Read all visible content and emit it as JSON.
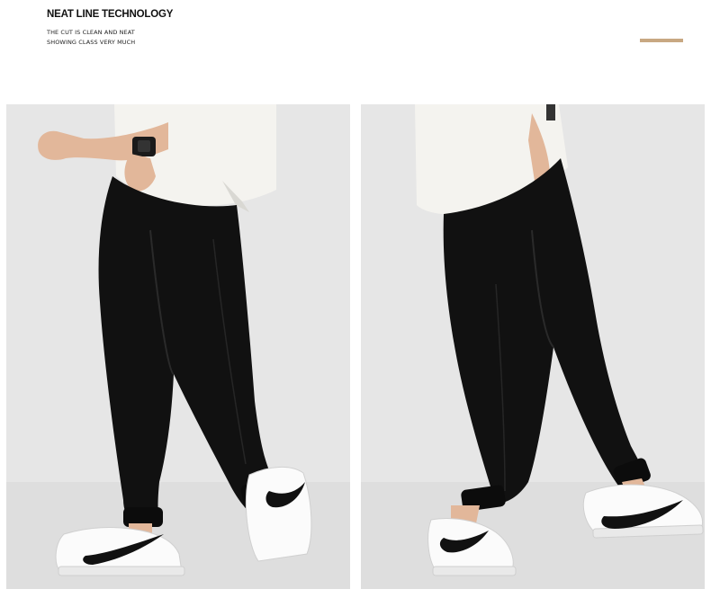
{
  "header": {
    "title": "NEAT LINE TECHNOLOGY",
    "subtitle_line1": "THE CUT IS CLEAN AND NEAT",
    "subtitle_line2": "SHOWING CLASS VERY MUCH"
  },
  "colors": {
    "accent": "#c8a882",
    "photo_background": "#e6e6e6",
    "pants": "#111111",
    "shirt": "#f4f3ef"
  },
  "photos": [
    {
      "subject": "model-wearing-black-jogger-pants-side-view",
      "shoe_brand_mark": "swoosh-icon"
    },
    {
      "subject": "model-wearing-black-jogger-pants-walking-view",
      "shoe_brand_mark": "swoosh-icon"
    }
  ]
}
